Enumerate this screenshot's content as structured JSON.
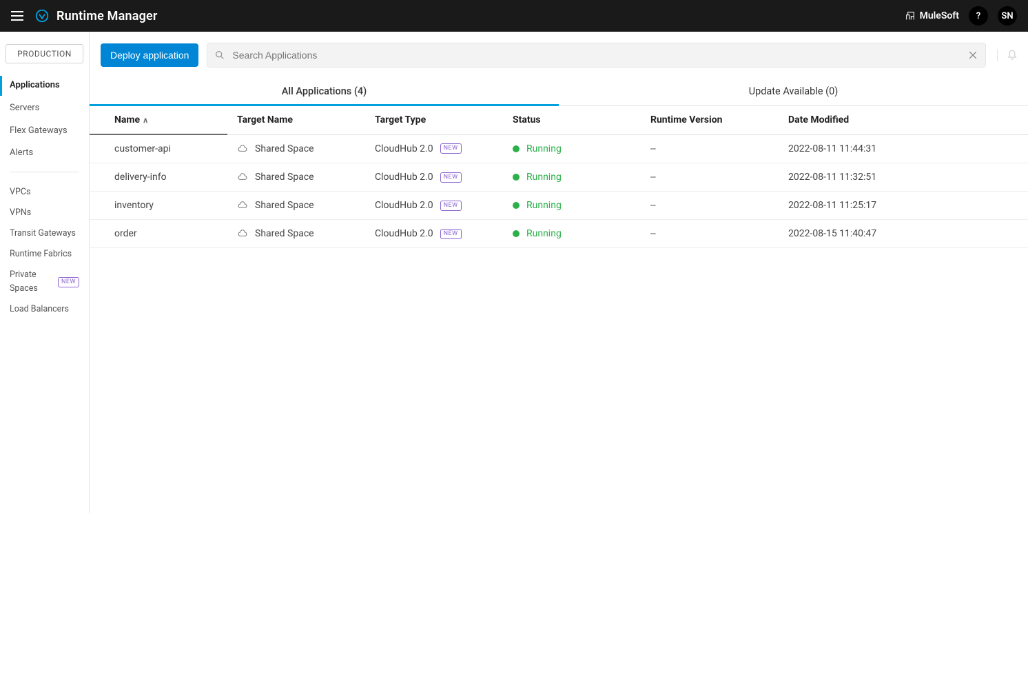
{
  "header": {
    "title": "Runtime Manager",
    "brand_label": "MuleSoft",
    "help_label": "?",
    "user_initials": "SN"
  },
  "sidebar": {
    "env_label": "PRODUCTION",
    "primary": [
      {
        "label": "Applications",
        "active": true
      },
      {
        "label": "Servers"
      },
      {
        "label": "Flex Gateways"
      },
      {
        "label": "Alerts"
      }
    ],
    "secondary": [
      {
        "label": "VPCs"
      },
      {
        "label": "VPNs"
      },
      {
        "label": "Transit Gateways"
      },
      {
        "label": "Runtime Fabrics"
      },
      {
        "label": "Private Spaces",
        "badge": "NEW"
      },
      {
        "label": "Load Balancers"
      }
    ]
  },
  "toolbar": {
    "deploy_label": "Deploy application",
    "search_placeholder": "Search Applications"
  },
  "tabs": [
    {
      "label": "All Applications (4)",
      "active": true
    },
    {
      "label": "Update Available (0)"
    }
  ],
  "table": {
    "columns": [
      "Name",
      "Target Name",
      "Target Type",
      "Status",
      "Runtime Version",
      "Date Modified"
    ],
    "type_badge": "NEW",
    "rows": [
      {
        "name": "customer-api",
        "target_name": "Shared Space",
        "target_type": "CloudHub 2.0",
        "status": "Running",
        "runtime_version": "--",
        "date_modified": "2022-08-11 11:44:31"
      },
      {
        "name": "delivery-info",
        "target_name": "Shared Space",
        "target_type": "CloudHub 2.0",
        "status": "Running",
        "runtime_version": "--",
        "date_modified": "2022-08-11 11:32:51"
      },
      {
        "name": "inventory",
        "target_name": "Shared Space",
        "target_type": "CloudHub 2.0",
        "status": "Running",
        "runtime_version": "--",
        "date_modified": "2022-08-11 11:25:17"
      },
      {
        "name": "order",
        "target_name": "Shared Space",
        "target_type": "CloudHub 2.0",
        "status": "Running",
        "runtime_version": "--",
        "date_modified": "2022-08-15 11:40:47"
      }
    ]
  }
}
